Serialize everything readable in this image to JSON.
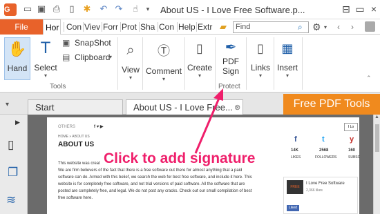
{
  "window": {
    "title": "About US - I Love Free Software.p..."
  },
  "ribbon_tabs": [
    "File",
    "Hor",
    "Con",
    "Viev",
    "Forr",
    "Prot",
    "Sha",
    "Con",
    "Help",
    "Extr"
  ],
  "search": {
    "value": "Find"
  },
  "groups": {
    "tools": {
      "label": "Tools",
      "hand": "Hand",
      "select": "Select",
      "snapshot": "SnapShot",
      "clipboard": "Clipboard"
    },
    "view": "View",
    "comment": "Comment",
    "create": "Create",
    "protect": {
      "label": "Protect",
      "pdf_sign_1": "PDF",
      "pdf_sign_2": "Sign"
    },
    "links": "Links",
    "insert": "Insert"
  },
  "doc_tabs": {
    "start": "Start",
    "active": "About US - I Love Free..."
  },
  "banner": "Free PDF Tools",
  "page": {
    "nav_others": "OTHERS",
    "breadcrumb": "HOME » ABOUT US",
    "heading": "ABOUT US",
    "para1": "This website was creat",
    "para2": "We are firm believers of the fact that there is a free software out there for almost anything that a paid",
    "para3": "software can do. Armed with this belief, we search the web for best free software, and include it here. This",
    "para4": "website is for completely free software, and not trial versions of paid software. All the software that are",
    "para5": "posted are completely free, and legal. We do not post any cracks. Check out our small compilation of best",
    "para6": "free software here.",
    "social": [
      {
        "icon": "f",
        "count": "14K",
        "label": "LIKES"
      },
      {
        "icon": "t",
        "count": "2568",
        "label": "FOLLOWERS"
      },
      {
        "icon": "y",
        "count": "160",
        "label": "SUBSC"
      }
    ],
    "widget_title": "I Love Free Software",
    "widget_sub": "2,366 likes",
    "liked": "Liked"
  },
  "annotation": "Click to add signature",
  "colors": {
    "accent": "#e8622a",
    "banner": "#f08a1e",
    "callout": "#ef1f6b"
  }
}
